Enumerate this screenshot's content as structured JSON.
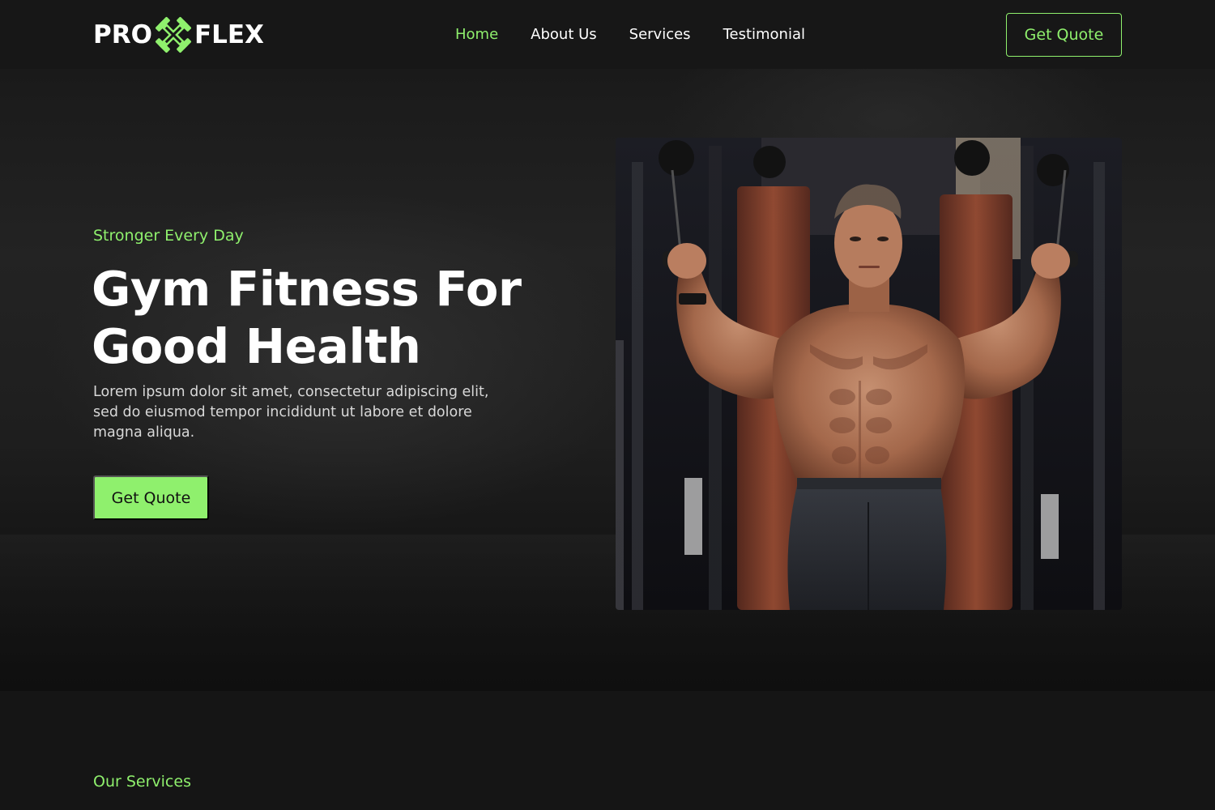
{
  "brand": {
    "logo_left": "PRO",
    "logo_right": "FLEX",
    "accent_color": "#8ff06d",
    "logo_icon": "dumbbell-cross-icon"
  },
  "nav": {
    "items": [
      {
        "label": "Home",
        "active": true
      },
      {
        "label": "About Us",
        "active": false
      },
      {
        "label": "Services",
        "active": false
      },
      {
        "label": "Testimonial",
        "active": false
      }
    ],
    "quote_label": "Get Quote"
  },
  "hero": {
    "subtitle": "Stronger Every Day",
    "title_line1": "Gym Fitness For",
    "title_line2": "Good Health",
    "description": "Lorem ipsum dolor sit amet, consectetur adipiscing elit, sed do eiusmod tempor incididunt ut labore et dolore magna aliqua.",
    "button_label": "Get Quote",
    "image_icon": "athlete-photo"
  },
  "services": {
    "section_label": "Our Services"
  }
}
